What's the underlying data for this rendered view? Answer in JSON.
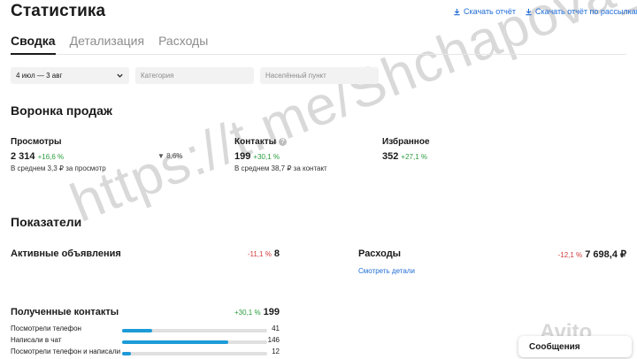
{
  "header": {
    "title": "Статистика",
    "download_report": "Скачать отчёт",
    "download_report_mailings": "Скачать отчёт по рассылкам"
  },
  "tabs": [
    {
      "label": "Сводка",
      "active": true
    },
    {
      "label": "Детализация",
      "active": false
    },
    {
      "label": "Расходы",
      "active": false
    }
  ],
  "filters": {
    "period": "4 июл — 3 авг",
    "category_placeholder": "Категория",
    "city_placeholder": "Населённый пункт"
  },
  "funnel": {
    "title": "Воронка продаж",
    "views": {
      "label": "Просмотры",
      "value": "2 314",
      "change": "+16,6 %",
      "sub": "В среднем 3,3 ₽ за просмотр"
    },
    "conversion": "8,6%",
    "contacts": {
      "label": "Контакты",
      "value": "199",
      "change": "+30,1 %",
      "sub": "В среднем 38,7 ₽ за контакт"
    },
    "favorites": {
      "label": "Избранное",
      "value": "352",
      "change": "+27,1 %"
    }
  },
  "indicators": {
    "title": "Показатели",
    "active_ads": {
      "label": "Активные объявления",
      "change": "-11,1 %",
      "value": "8"
    },
    "expenses": {
      "label": "Расходы",
      "change": "-12,1 %",
      "value": "7 698,4 ₽",
      "link": "Смотреть детали"
    },
    "received_contacts": {
      "label": "Полученные контакты",
      "change": "+30,1 %",
      "value": "199",
      "rows": [
        {
          "label": "Посмотрели телефон",
          "value": "41",
          "fraction": 0.21
        },
        {
          "label": "Написали в чат",
          "value": "146",
          "fraction": 0.73
        },
        {
          "label": "Посмотрели телефон и написали",
          "value": "12",
          "fraction": 0.06
        }
      ]
    }
  },
  "messages_button": "Сообщения",
  "watermark": "https://t.me/Shchapova_T",
  "colors": {
    "accent_link": "#1e6bd6",
    "positive": "#2a9d3e",
    "negative": "#d33a3a",
    "bar": "#1c9bd8"
  }
}
